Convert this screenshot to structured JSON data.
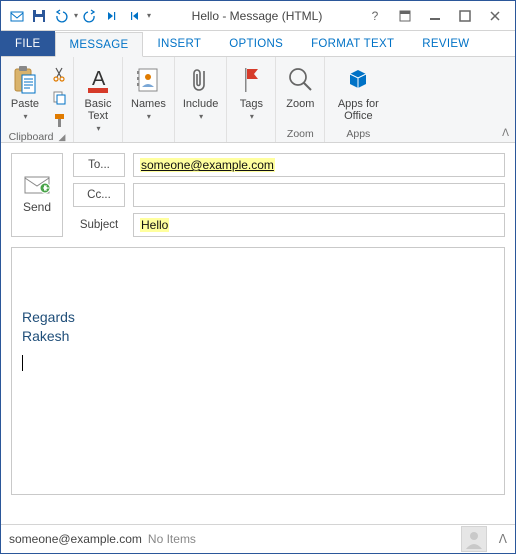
{
  "window": {
    "title": "Hello - Message (HTML)"
  },
  "tabs": {
    "file": "FILE",
    "message": "MESSAGE",
    "insert": "INSERT",
    "options": "OPTIONS",
    "format_text": "FORMAT TEXT",
    "review": "REVIEW"
  },
  "ribbon": {
    "clipboard": {
      "label": "Clipboard",
      "paste": "Paste"
    },
    "basic_text": {
      "label": "Basic\nText"
    },
    "names": {
      "label": "Names"
    },
    "include": {
      "label": "Include"
    },
    "tags": {
      "label": "Tags"
    },
    "zoom": {
      "btn": "Zoom",
      "group": "Zoom"
    },
    "apps": {
      "btn": "Apps for\nOffice",
      "group": "Apps"
    }
  },
  "compose": {
    "send": "Send",
    "to_label": "To...",
    "cc_label": "Cc...",
    "subject_label": "Subject",
    "to_value": "someone@example.com",
    "cc_value": "",
    "subject_value": "Hello"
  },
  "body": {
    "line1": "Regards",
    "line2": "Rakesh"
  },
  "status": {
    "addr": "someone@example.com",
    "noitems": "No Items"
  }
}
